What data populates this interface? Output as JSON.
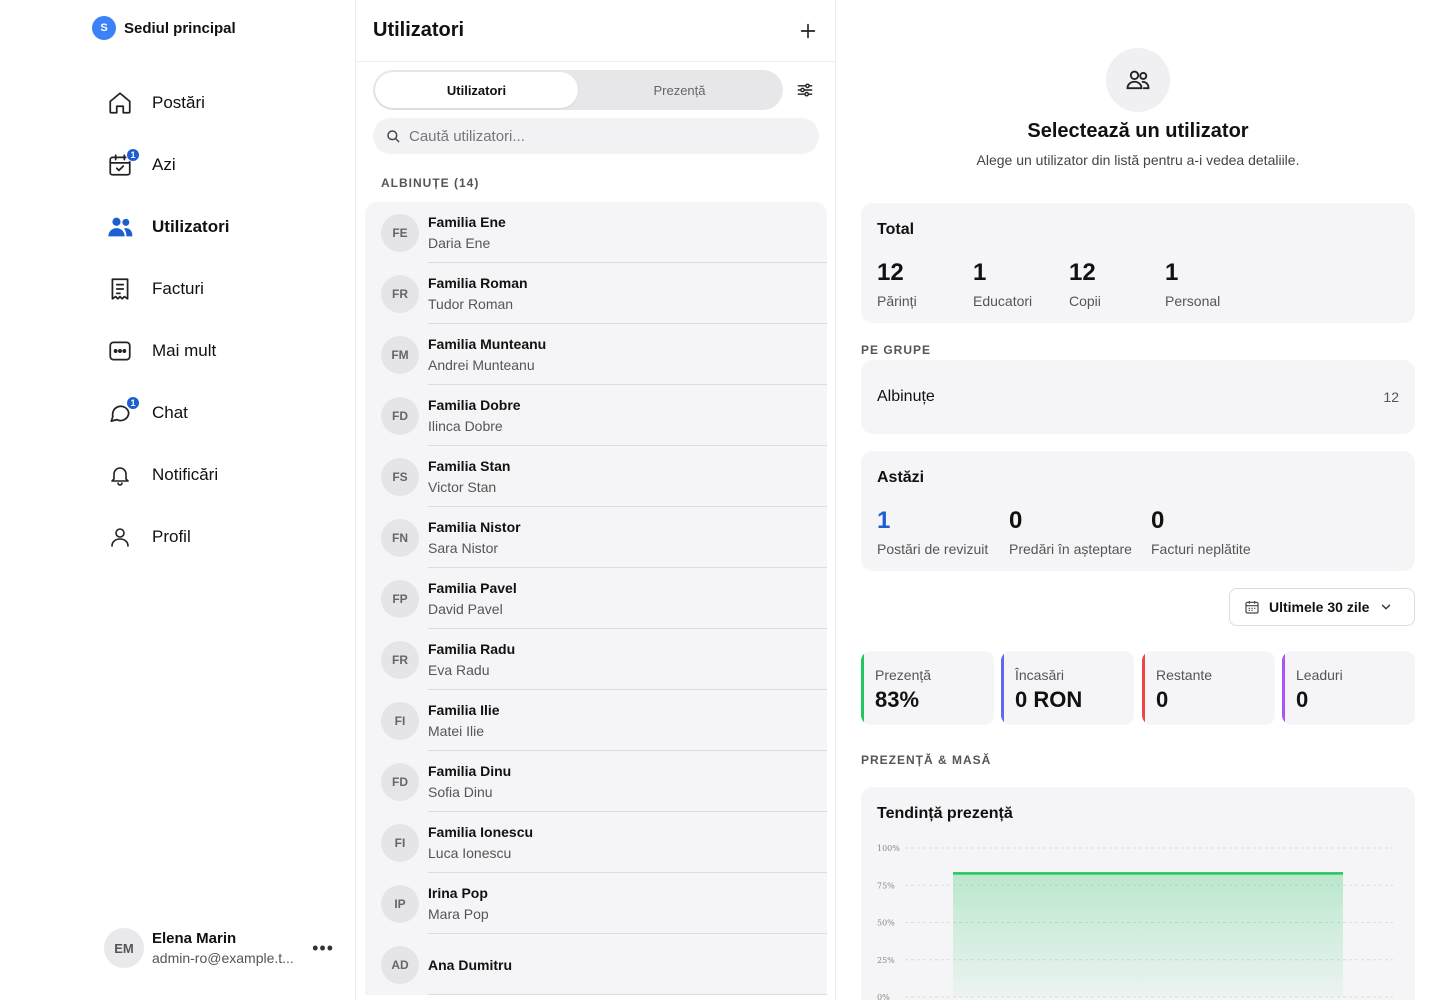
{
  "sidebar": {
    "brand": {
      "initial": "S",
      "name": "Sediul principal"
    },
    "nav": [
      {
        "label": "Postări",
        "icon": "home-icon"
      },
      {
        "label": "Azi",
        "icon": "calendar-check-icon",
        "badge": "1"
      },
      {
        "label": "Utilizatori",
        "icon": "users-icon",
        "active": true
      },
      {
        "label": "Facturi",
        "icon": "receipt-icon"
      },
      {
        "label": "Mai mult",
        "icon": "more-box-icon"
      },
      {
        "label": "Chat",
        "icon": "chat-icon",
        "badge": "1"
      },
      {
        "label": "Notificări",
        "icon": "bell-icon"
      },
      {
        "label": "Profil",
        "icon": "profile-icon"
      }
    ],
    "user": {
      "initials": "EM",
      "name": "Elena Marin",
      "email": "admin-ro@example.t...",
      "more": "•••"
    }
  },
  "list": {
    "title": "Utilizatori",
    "tabs": [
      "Utilizatori",
      "Prezență"
    ],
    "search_placeholder": "Caută utilizatori...",
    "group": "ALBINUȚE (14)",
    "rows": [
      {
        "initials": "FE",
        "name": "Familia Ene",
        "sub": "Daria Ene"
      },
      {
        "initials": "FR",
        "name": "Familia Roman",
        "sub": "Tudor Roman"
      },
      {
        "initials": "FM",
        "name": "Familia Munteanu",
        "sub": "Andrei Munteanu"
      },
      {
        "initials": "FD",
        "name": "Familia Dobre",
        "sub": "Ilinca Dobre"
      },
      {
        "initials": "FS",
        "name": "Familia Stan",
        "sub": "Victor Stan"
      },
      {
        "initials": "FN",
        "name": "Familia Nistor",
        "sub": "Sara Nistor"
      },
      {
        "initials": "FP",
        "name": "Familia Pavel",
        "sub": "David Pavel"
      },
      {
        "initials": "FR",
        "name": "Familia Radu",
        "sub": "Eva Radu"
      },
      {
        "initials": "FI",
        "name": "Familia Ilie",
        "sub": "Matei Ilie"
      },
      {
        "initials": "FD",
        "name": "Familia Dinu",
        "sub": "Sofia Dinu"
      },
      {
        "initials": "FI",
        "name": "Familia Ionescu",
        "sub": "Luca Ionescu"
      },
      {
        "initials": "IP",
        "name": "Irina Pop",
        "sub": "Mara Pop"
      },
      {
        "initials": "AD",
        "name": "Ana Dumitru",
        "sub": ""
      }
    ]
  },
  "detail": {
    "empty_title": "Selectează un utilizator",
    "empty_sub": "Alege un utilizator din listă pentru a-i vedea detaliile.",
    "total": {
      "title": "Total",
      "stats": [
        {
          "value": "12",
          "label": "Părinți"
        },
        {
          "value": "1",
          "label": "Educatori"
        },
        {
          "value": "12",
          "label": "Copii"
        },
        {
          "value": "1",
          "label": "Personal"
        }
      ]
    },
    "groups_head": "PE GRUPE",
    "groups": [
      {
        "name": "Albinuțe",
        "count": "12"
      }
    ],
    "today": {
      "title": "Astăzi",
      "stats": [
        {
          "value": "1",
          "label": "Postări de revizuit",
          "color": "#1d5fd1"
        },
        {
          "value": "0",
          "label": "Predări în așteptare",
          "color": "#111111"
        },
        {
          "value": "0",
          "label": "Facturi neplătite",
          "color": "#111111"
        }
      ]
    },
    "range": "Ultimele 30 zile",
    "kpis": [
      {
        "label": "Prezență",
        "value": "83%",
        "color": "#22c55e"
      },
      {
        "label": "Încasări",
        "value": "0 RON",
        "color": "#6366f1"
      },
      {
        "label": "Restante",
        "value": "0",
        "color": "#ef4444"
      },
      {
        "label": "Leaduri",
        "value": "0",
        "color": "#a855f7"
      }
    ],
    "section_attendance": "PREZENȚĂ & MASĂ",
    "trend_title": "Tendință prezență"
  },
  "chart_data": {
    "type": "area",
    "title": "Tendință prezență",
    "y_ticks": [
      "100%",
      "75%",
      "50%",
      "25%",
      "0%"
    ],
    "ylim": [
      0,
      100
    ],
    "series": [
      {
        "values": [
          83,
          83
        ]
      }
    ],
    "color": "#22c55e",
    "grid": true
  }
}
